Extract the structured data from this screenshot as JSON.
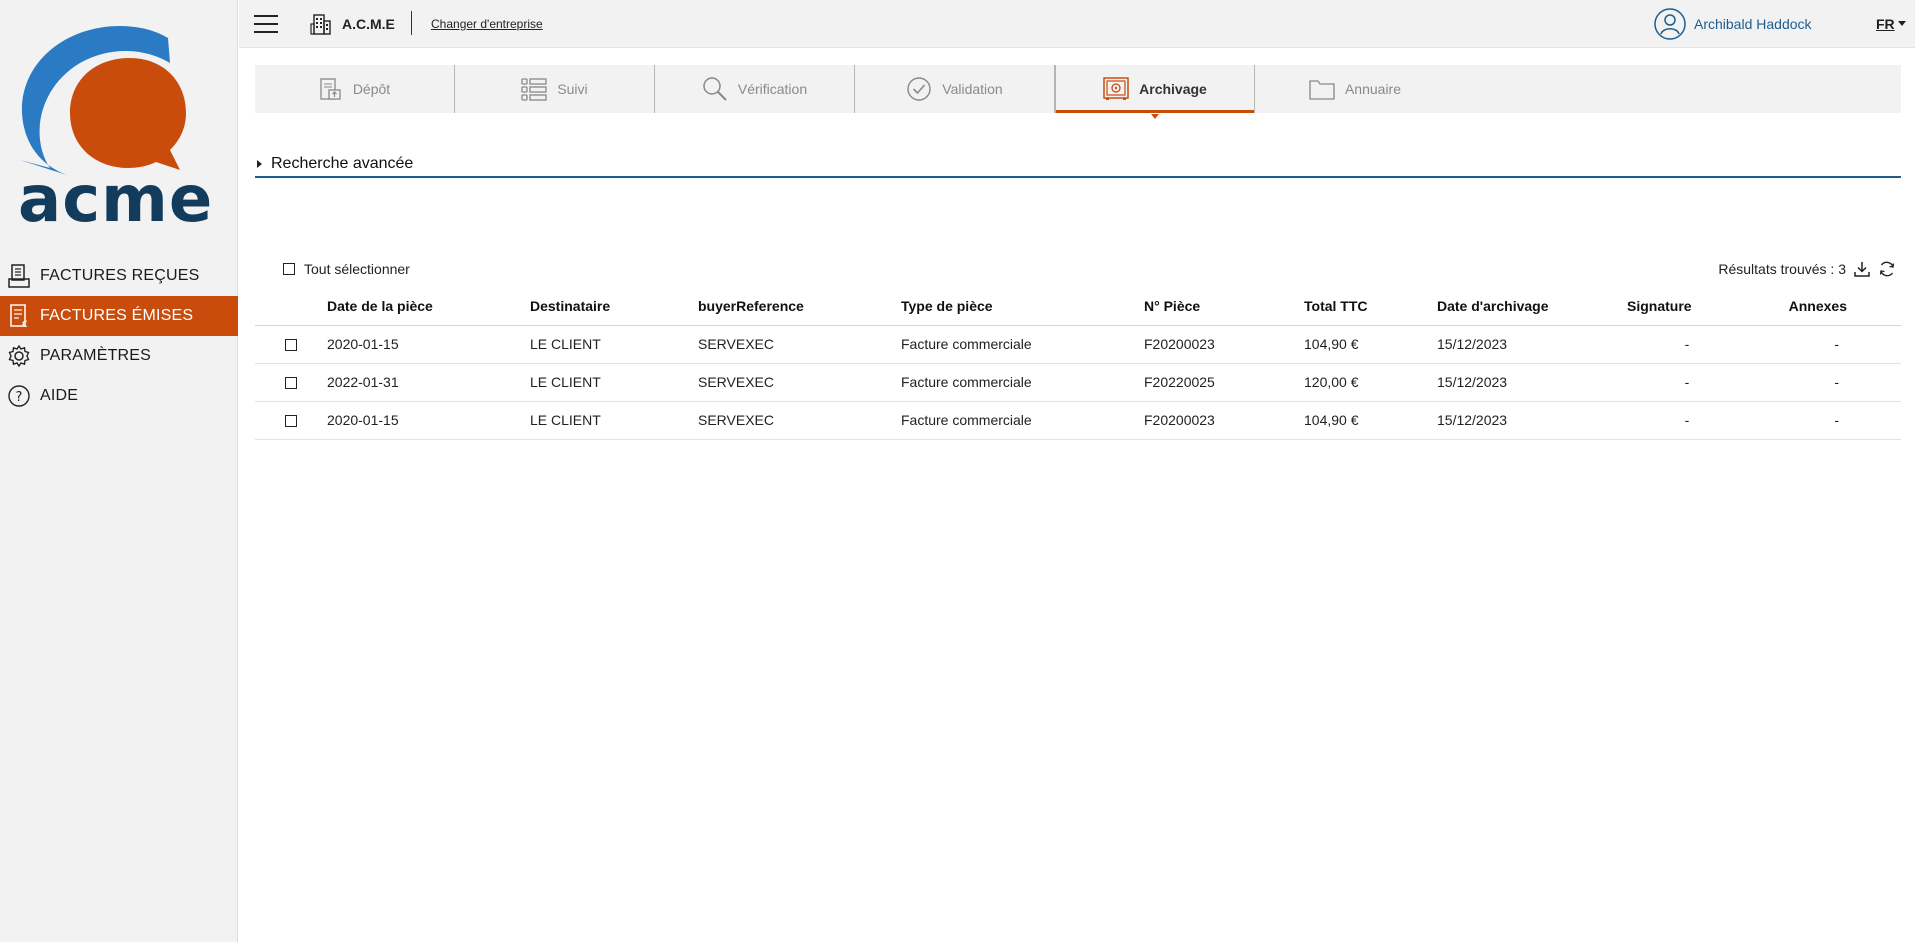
{
  "app": {
    "logo_text": "acme",
    "company": "A.C.M.E",
    "change_company": "Changer d'entreprise",
    "user": "Archibald Haddock",
    "lang": "FR"
  },
  "colors": {
    "accent": "#c94c0d",
    "brand_blue": "#2a7bc4",
    "navy": "#123b5c",
    "link_blue": "#1d5e8e"
  },
  "sidebar": {
    "items": [
      {
        "label": "FACTURES REÇUES",
        "icon": "invoice-received-icon"
      },
      {
        "label": "FACTURES ÉMISES",
        "icon": "invoice-sent-icon",
        "active": true
      },
      {
        "label": "PARAMÈTRES",
        "icon": "gear-icon"
      },
      {
        "label": "AIDE",
        "icon": "help-icon"
      }
    ]
  },
  "tabs": [
    {
      "label": "Dépôt",
      "icon": "upload-document-icon"
    },
    {
      "label": "Suivi",
      "icon": "list-icon"
    },
    {
      "label": "Vérification",
      "icon": "search-icon"
    },
    {
      "label": "Validation",
      "icon": "check-circle-icon"
    },
    {
      "label": "Archivage",
      "icon": "safe-icon",
      "active": true
    },
    {
      "label": "Annuaire",
      "icon": "folder-icon"
    }
  ],
  "advanced_search": "Recherche avancée",
  "select_all": "Tout sélectionner",
  "results_label": "Résultats trouvés : 3",
  "table": {
    "headers": [
      "Date de la pièce",
      "Destinataire",
      "buyerReference",
      "Type de pièce",
      "N° Pièce",
      "Total TTC",
      "Date d'archivage",
      "Signature",
      "Annexes"
    ],
    "rows": [
      [
        "2020-01-15",
        "LE CLIENT",
        "SERVEXEC",
        "Facture commerciale",
        "F20200023",
        "104,90 €",
        "15/12/2023",
        "-",
        "-"
      ],
      [
        "2022-01-31",
        "LE CLIENT",
        "SERVEXEC",
        "Facture commerciale",
        "F20220025",
        "120,00 €",
        "15/12/2023",
        "-",
        "-"
      ],
      [
        "2020-01-15",
        "LE CLIENT",
        "SERVEXEC",
        "Facture commerciale",
        "F20200023",
        "104,90 €",
        "15/12/2023",
        "-",
        "-"
      ]
    ]
  }
}
